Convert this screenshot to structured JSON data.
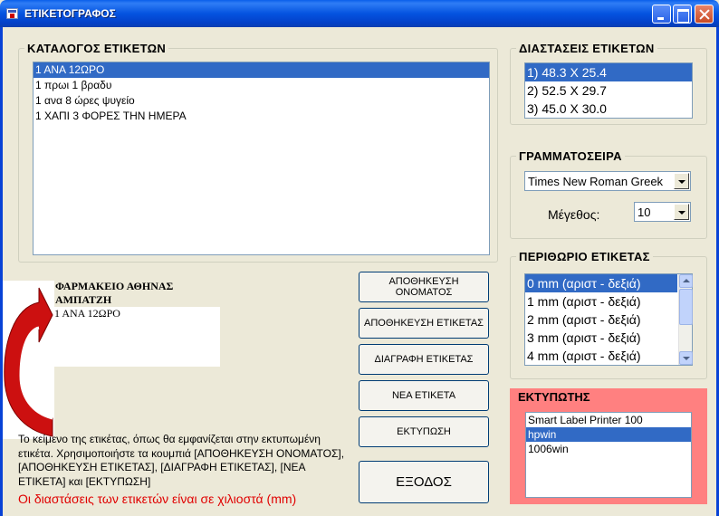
{
  "window": {
    "title": "ΕΤΙΚΕΤΟΓΡΑΦΟΣ"
  },
  "catalog": {
    "label": "ΚΑΤΑΛΟΓΟΣ ΕΤΙΚΕΤΩΝ",
    "items": [
      "1 ΑΝΑ 12ΩΡΟ",
      "1 πρωι 1 βραδυ",
      "1 ανα 8 ώρες ψυγείο",
      "1 ΧΑΠΙ 3 ΦΟΡΕΣ ΤΗΝ ΗΜΕΡΑ"
    ],
    "selected_index": 0
  },
  "dimensions": {
    "label": "ΔΙΑΣΤΑΣΕΙΣ ΕΤΙΚΕΤΩΝ",
    "items": [
      "1) 48.3 X 25.4",
      "2) 52.5 X 29.7",
      "3) 45.0 X 30.0"
    ],
    "selected_index": 0
  },
  "font": {
    "label": "ΓΡΑΜΜΑΤΟΣΕΙΡΑ",
    "family_value": "Times New Roman Greek",
    "size_label": "Μέγεθος:",
    "size_value": "10"
  },
  "margin": {
    "label": "ΠΕΡΙΘΩΡΙΟ ΕΤΙΚΕΤΑΣ",
    "items": [
      "0 mm (αριστ - δεξιά)",
      "1 mm (αριστ - δεξιά)",
      "2 mm (αριστ - δεξιά)",
      "3 mm (αριστ - δεξιά)",
      "4 mm (αριστ - δεξιά)"
    ],
    "selected_index": 0
  },
  "printer": {
    "label": "ΕΚΤΥΠΩΤΗΣ",
    "items": [
      "Smart Label Printer 100",
      "hpwin",
      "1006win"
    ],
    "selected_index": 1
  },
  "preview": {
    "store_name": "ΦΑΡΜΑΚΕΙΟ ΑΘΗΝΑΣ ΑΜΠΑΤΖΗ",
    "label_text": "1 ΑΝΑ 12ΩΡΟ"
  },
  "buttons": {
    "save_name": "ΑΠΟΘΗΚΕΥΣΗ ΟΝΟΜΑΤΟΣ",
    "save_label": "ΑΠΟΘΗΚΕΥΣΗ ΕΤΙΚΕΤΑΣ",
    "delete_label": "ΔΙΑΓΡΑΦΗ ΕΤΙΚΕΤΑΣ",
    "new_label": "ΝΕΑ ΕΤΙΚΕΤΑ",
    "print": "ΕΚΤΥΠΩΣΗ",
    "exit": "ΕΞΟΔΟΣ"
  },
  "info": {
    "text": "Το κείμενο της ετικέτας, όπως θα εμφανίζεται στην εκτυπωμένη ετικέτα. Χρησιμοποιήστε τα κουμπιά [ΑΠΟΘΗΚΕΥΣΗ ΟΝΟΜΑΤΟΣ], [ΑΠΟΘΗΚΕΥΣΗ ΕΤΙΚΕΤΑΣ], [ΔΙΑΓΡΑΦΗ ΕΤΙΚΕΤΑΣ], [ΝΕΑ ΕΤΙΚΕΤΑ] και [ΕΚΤΥΠΩΣΗ]",
    "note": "Οι διαστάσεις των ετικετών είναι σε χιλιοστά (mm)"
  },
  "colors": {
    "selection": "#316AC5",
    "printer_panel": "#FF8080",
    "note_red": "#E00000",
    "titlebar": "#0453E0"
  }
}
